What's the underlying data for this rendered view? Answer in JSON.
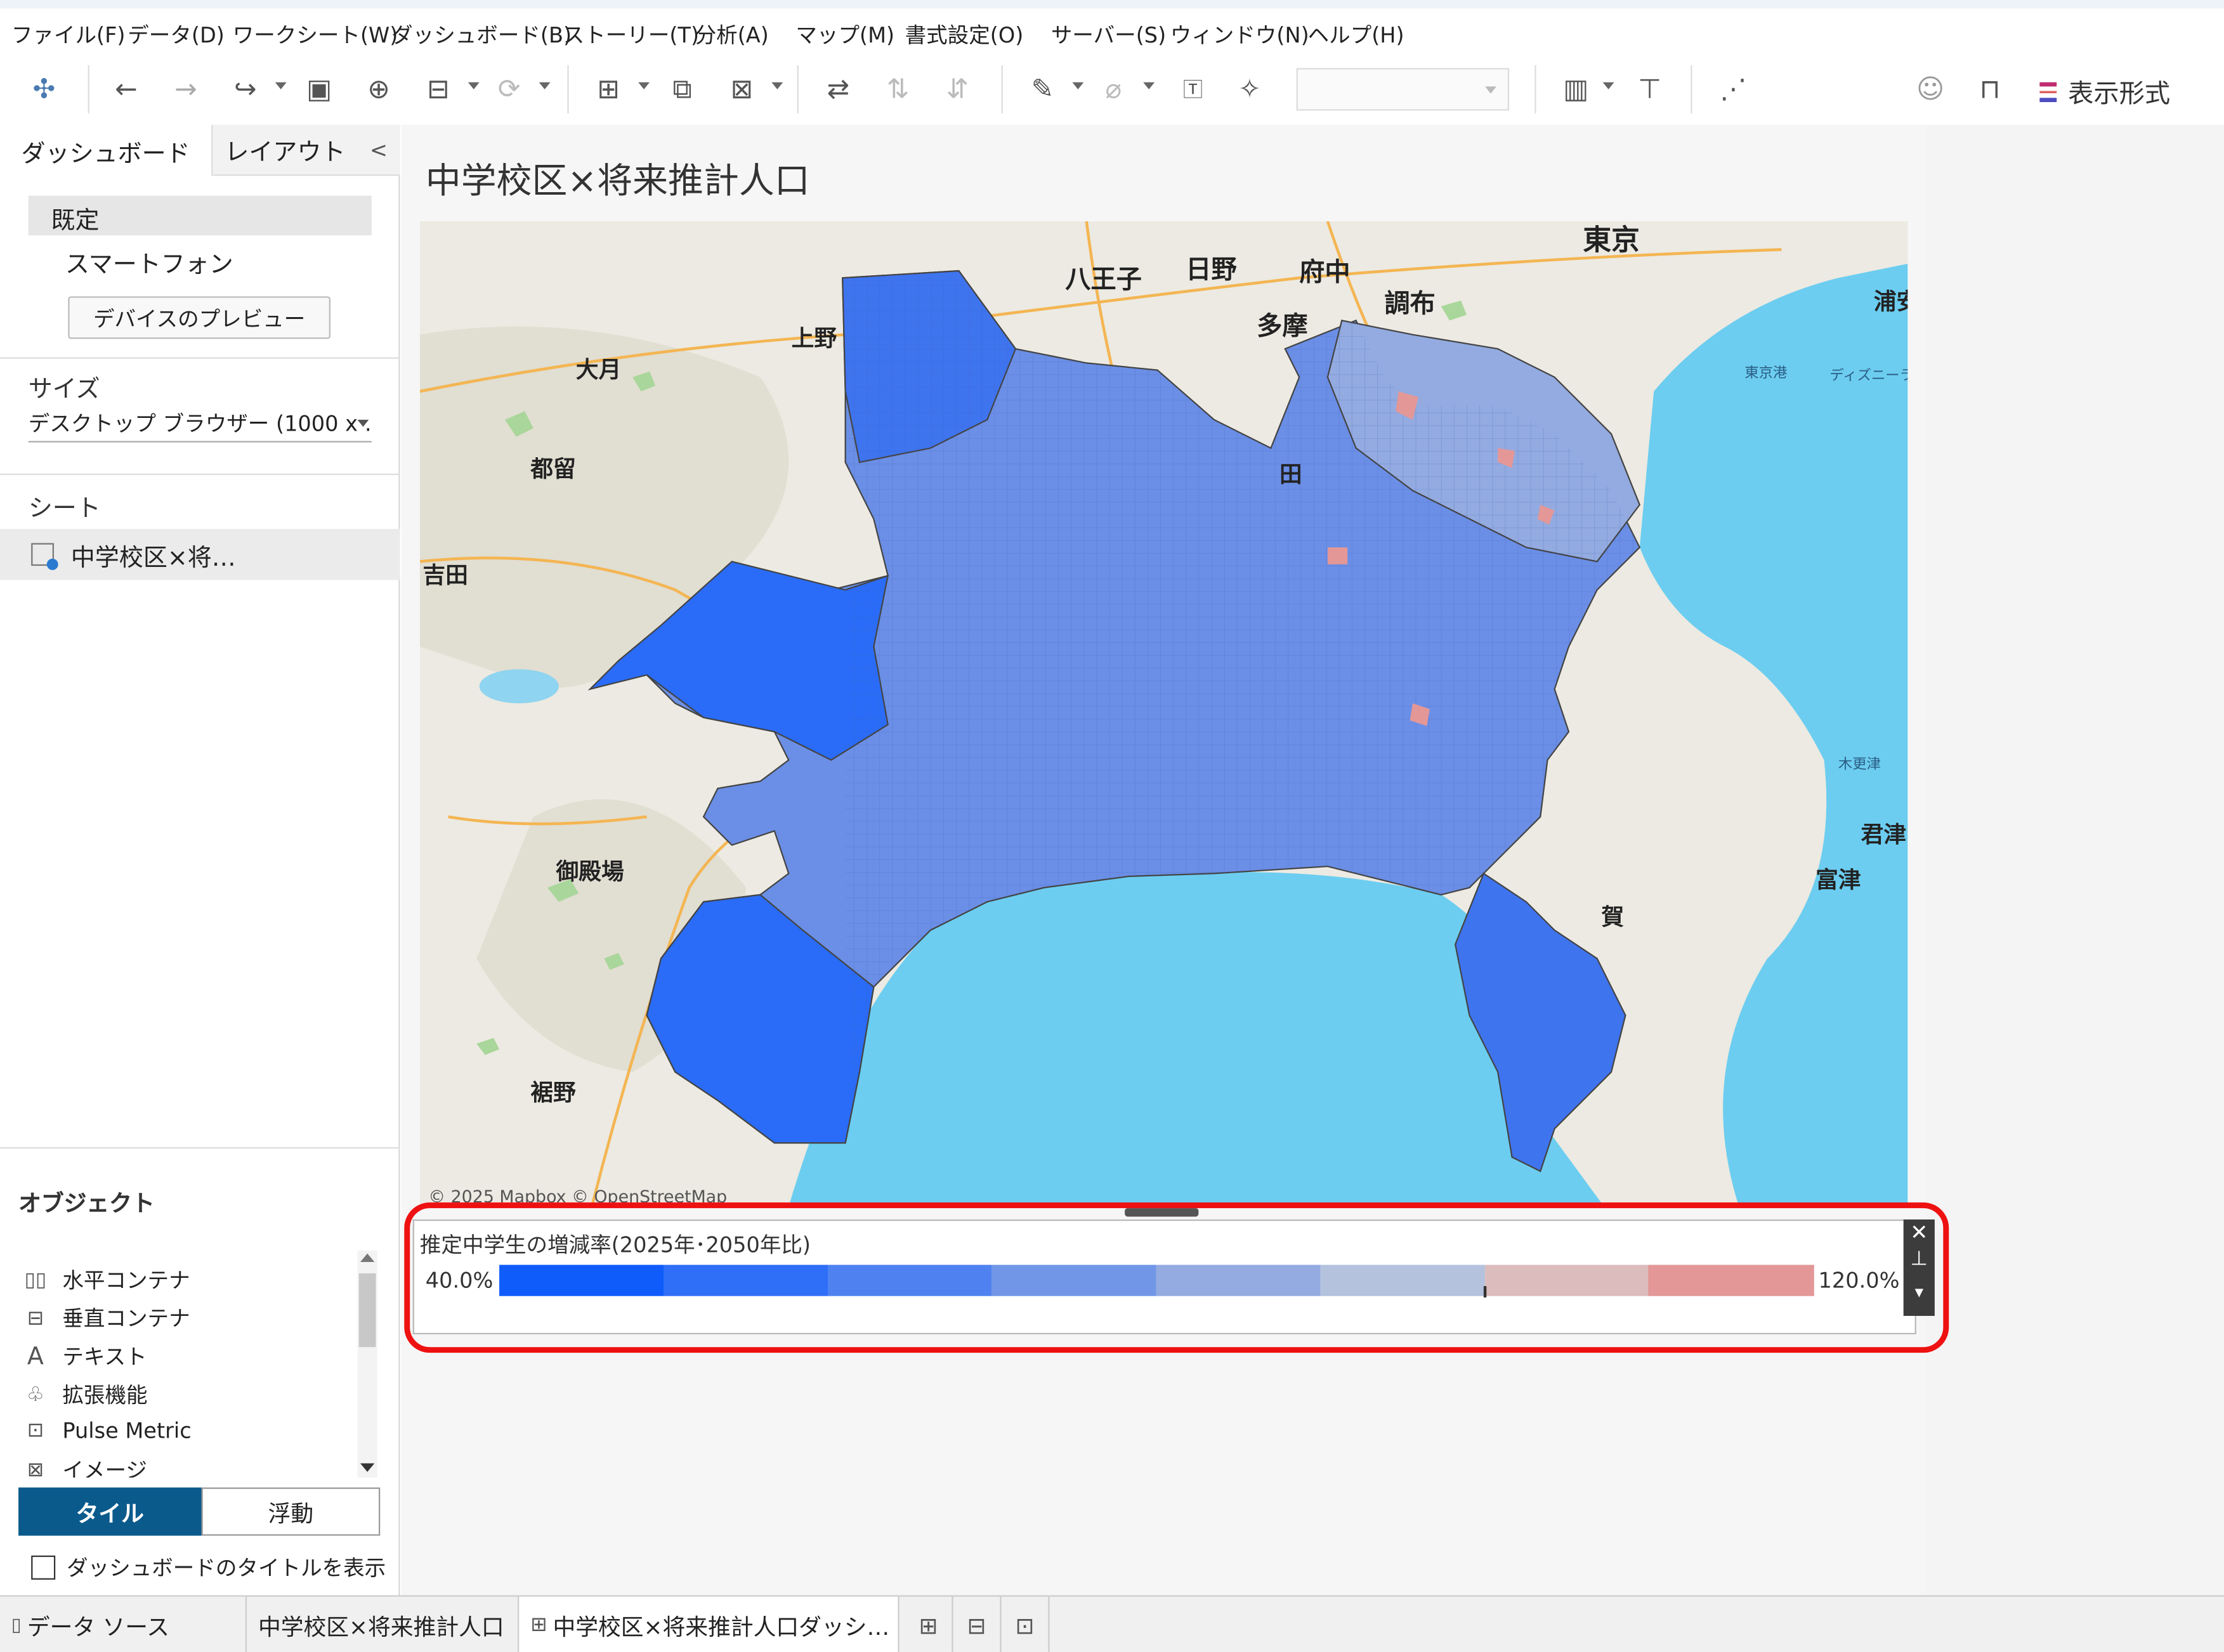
{
  "menu": [
    "ファイル(F)",
    "データ(D)",
    "ワークシート(W)",
    "ダッシュボード(B)",
    "ストーリー(T)",
    "分析(A)",
    "マップ(M)",
    "書式設定(O)",
    "サーバー(S)",
    "ウィンドウ(N)",
    "ヘルプ(H)"
  ],
  "toolbar": {
    "format_label": "表示形式"
  },
  "left": {
    "tab_dashboard": "ダッシュボード",
    "tab_layout": "レイアウト",
    "collapse": "<",
    "device_default": "既定",
    "device_phone": "スマートフォン",
    "device_preview": "デバイスのプレビュー",
    "size_title": "サイズ",
    "size_value": "デスクトップ ブラウザー (1000 x …",
    "sheets_title": "シート",
    "sheet_item": "中学校区×将…",
    "objects_title": "オブジェクト",
    "objects": [
      "水平コンテナ",
      "垂直コンテナ",
      "テキスト",
      "拡張機能",
      "Pulse Metric",
      "イメージ"
    ],
    "object_icons": [
      "horizontal-container-icon",
      "vertical-container-icon",
      "text-icon",
      "extension-icon",
      "pulse-metric-icon",
      "image-icon"
    ],
    "tile": "タイル",
    "floating": "浮動",
    "show_title": "ダッシュボードのタイトルを表示"
  },
  "dashboard": {
    "title": "中学校区×将来推計人口",
    "map_labels": [
      "東京",
      "八王子",
      "日野",
      "府中",
      "調布",
      "多摩",
      "上野",
      "大月",
      "都留",
      "吉田",
      "御殿場",
      "裾野",
      "浦安",
      "東京港",
      "ディズニーラ",
      "木更津",
      "君津",
      "富津",
      "賀",
      "田"
    ],
    "attribution": "© 2025 Mapbox © OpenStreetMap",
    "legend": {
      "title": "推定中学生の増減率(2025年･2050年比)",
      "min": "40.0%",
      "max": "120.0%",
      "colors": [
        "#0f5cfb",
        "#2f6ef6",
        "#4f82f0",
        "#7196e8",
        "#93abe0",
        "#b5c2de",
        "#dcbcbc",
        "#e39797"
      ]
    }
  },
  "tabs": {
    "data_source": "データ ソース",
    "sheet": "中学校区×将来推計人口",
    "dashboard": "中学校区×将来推計人口ダッシ…"
  },
  "colors": {
    "accent": "#0b5a8c",
    "highlight": "#ee1111",
    "sea": "#6ccdf0",
    "land": "#eceae2"
  }
}
